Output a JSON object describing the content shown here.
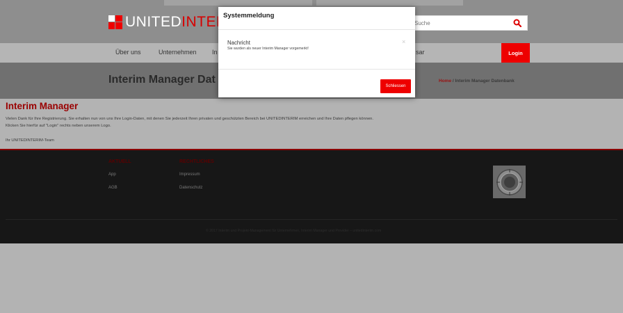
{
  "header": {
    "logo_text_white": "UNITED",
    "logo_text_red": "INTERIM",
    "search_placeholder": "Suche"
  },
  "nav": {
    "items": [
      "Über uns",
      "Unternehmen",
      "In",
      "sar"
    ],
    "login_label": "Login"
  },
  "title_band": {
    "page_title": "Interim Manager Dat",
    "breadcrumb_home": "Home",
    "breadcrumb_sep": "/",
    "breadcrumb_current": "Interim Manager Datenbank"
  },
  "content": {
    "heading": "Interim Manager",
    "paragraph_1": "Vielen Dank für Ihre Registrierung. Sie erhalten nun von uns Ihre Login-Daten, mit denen Sie jederzeit Ihren privaten und geschützten Bereich bei UNITEDINTERIM erreichen und Ihre Daten pflegen können.",
    "paragraph_2": "Klicken Sie hierfür auf \"Login\" rechts neben unserem Logo.",
    "signature": "Ihr UNITEDINTERIM-Team"
  },
  "footer": {
    "col1_heading": "AKTUELL",
    "col1_links": [
      "App",
      "AGB"
    ],
    "col2_heading": "RECHTLICHES",
    "col2_links": [
      "Impressum",
      "Datenschutz"
    ],
    "copyright": "© 2017 Interim und Projekt-Management für Unternehmen, Interim Manager und Provider – unitedinterim.com"
  },
  "modal": {
    "title": "Systemmeldung",
    "alert_title": "Nachricht",
    "alert_text": "Sie wurden als neuer Interim Manager vorgemerkt!",
    "alert_close": "×",
    "close_button": "Schliessen"
  },
  "colors": {
    "accent_red": "#e00000",
    "dark_red": "#9a0000",
    "footer_bg": "#171717"
  },
  "icons": {
    "search": "search-icon",
    "logo": "logo-squares-icon",
    "seal": "seal-icon"
  }
}
